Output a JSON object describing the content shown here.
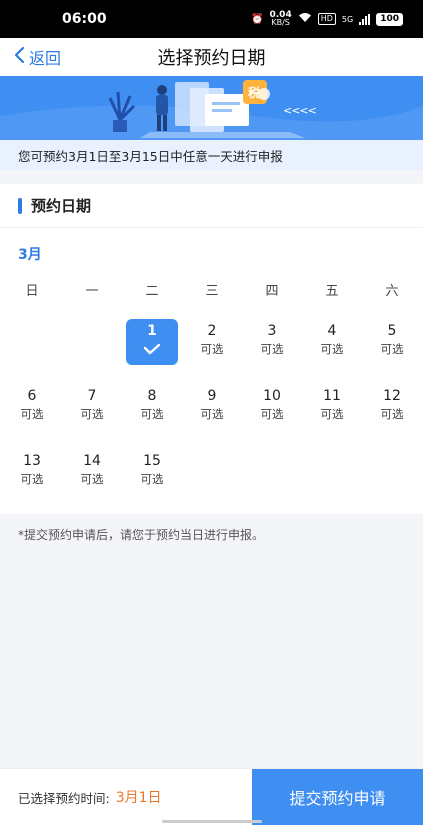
{
  "status_bar": {
    "time": "06:00",
    "speed_value": "0.04",
    "speed_unit": "KB/S",
    "hd": "HD",
    "network": "5G",
    "battery": "100"
  },
  "nav": {
    "back_label": "返回",
    "title": "选择预约日期"
  },
  "banner": {
    "tax_badge": "税",
    "arrows": "<<<<"
  },
  "notice": "您可预约3月1日至3月15日中任意一天进行申报",
  "section": {
    "title": "预约日期"
  },
  "calendar": {
    "month": "3月",
    "weekdays": [
      "日",
      "一",
      "二",
      "三",
      "四",
      "五",
      "六"
    ],
    "rows": [
      [
        {
          "day": "",
          "status": ""
        },
        {
          "day": "",
          "status": ""
        },
        {
          "day": "1",
          "status": "",
          "selected": true
        },
        {
          "day": "2",
          "status": "可选"
        },
        {
          "day": "3",
          "status": "可选"
        },
        {
          "day": "4",
          "status": "可选"
        },
        {
          "day": "5",
          "status": "可选"
        }
      ],
      [
        {
          "day": "6",
          "status": "可选"
        },
        {
          "day": "7",
          "status": "可选"
        },
        {
          "day": "8",
          "status": "可选"
        },
        {
          "day": "9",
          "status": "可选"
        },
        {
          "day": "10",
          "status": "可选"
        },
        {
          "day": "11",
          "status": "可选"
        },
        {
          "day": "12",
          "status": "可选"
        }
      ],
      [
        {
          "day": "13",
          "status": "可选"
        },
        {
          "day": "14",
          "status": "可选"
        },
        {
          "day": "15",
          "status": "可选"
        },
        {
          "day": "",
          "status": ""
        },
        {
          "day": "",
          "status": ""
        },
        {
          "day": "",
          "status": ""
        },
        {
          "day": "",
          "status": ""
        }
      ]
    ]
  },
  "footnote": "*提交预约申请后，请您于预约当日进行申报。",
  "bottom": {
    "selected_label": "已选择预约时间:",
    "selected_value": "3月1日",
    "submit_label": "提交预约申请"
  },
  "colors": {
    "accent": "#3f8ef2",
    "link": "#2d7be5",
    "highlight": "#e8772e"
  }
}
